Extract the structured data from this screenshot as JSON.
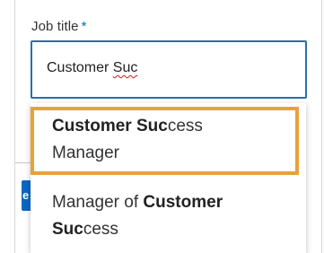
{
  "field": {
    "label": "Job title",
    "required_marker": "*",
    "value_prefix": "Customer ",
    "value_misspelled": "Suc"
  },
  "suggestions": [
    {
      "line1_bold": "Customer Suc",
      "line1_rest": "cess",
      "line2": "Manager",
      "highlighted": true
    },
    {
      "line1_plain": "Manager of ",
      "line1_bold": "Customer",
      "line2_bold": "Suc",
      "line2_rest": "cess",
      "highlighted": false
    }
  ],
  "background_button": {
    "glyph": "e"
  },
  "colors": {
    "accent": "#0a66c2",
    "input_border": "#2c6fa8",
    "highlight_border": "#e8a23a",
    "spellcheck": "#d11919"
  }
}
